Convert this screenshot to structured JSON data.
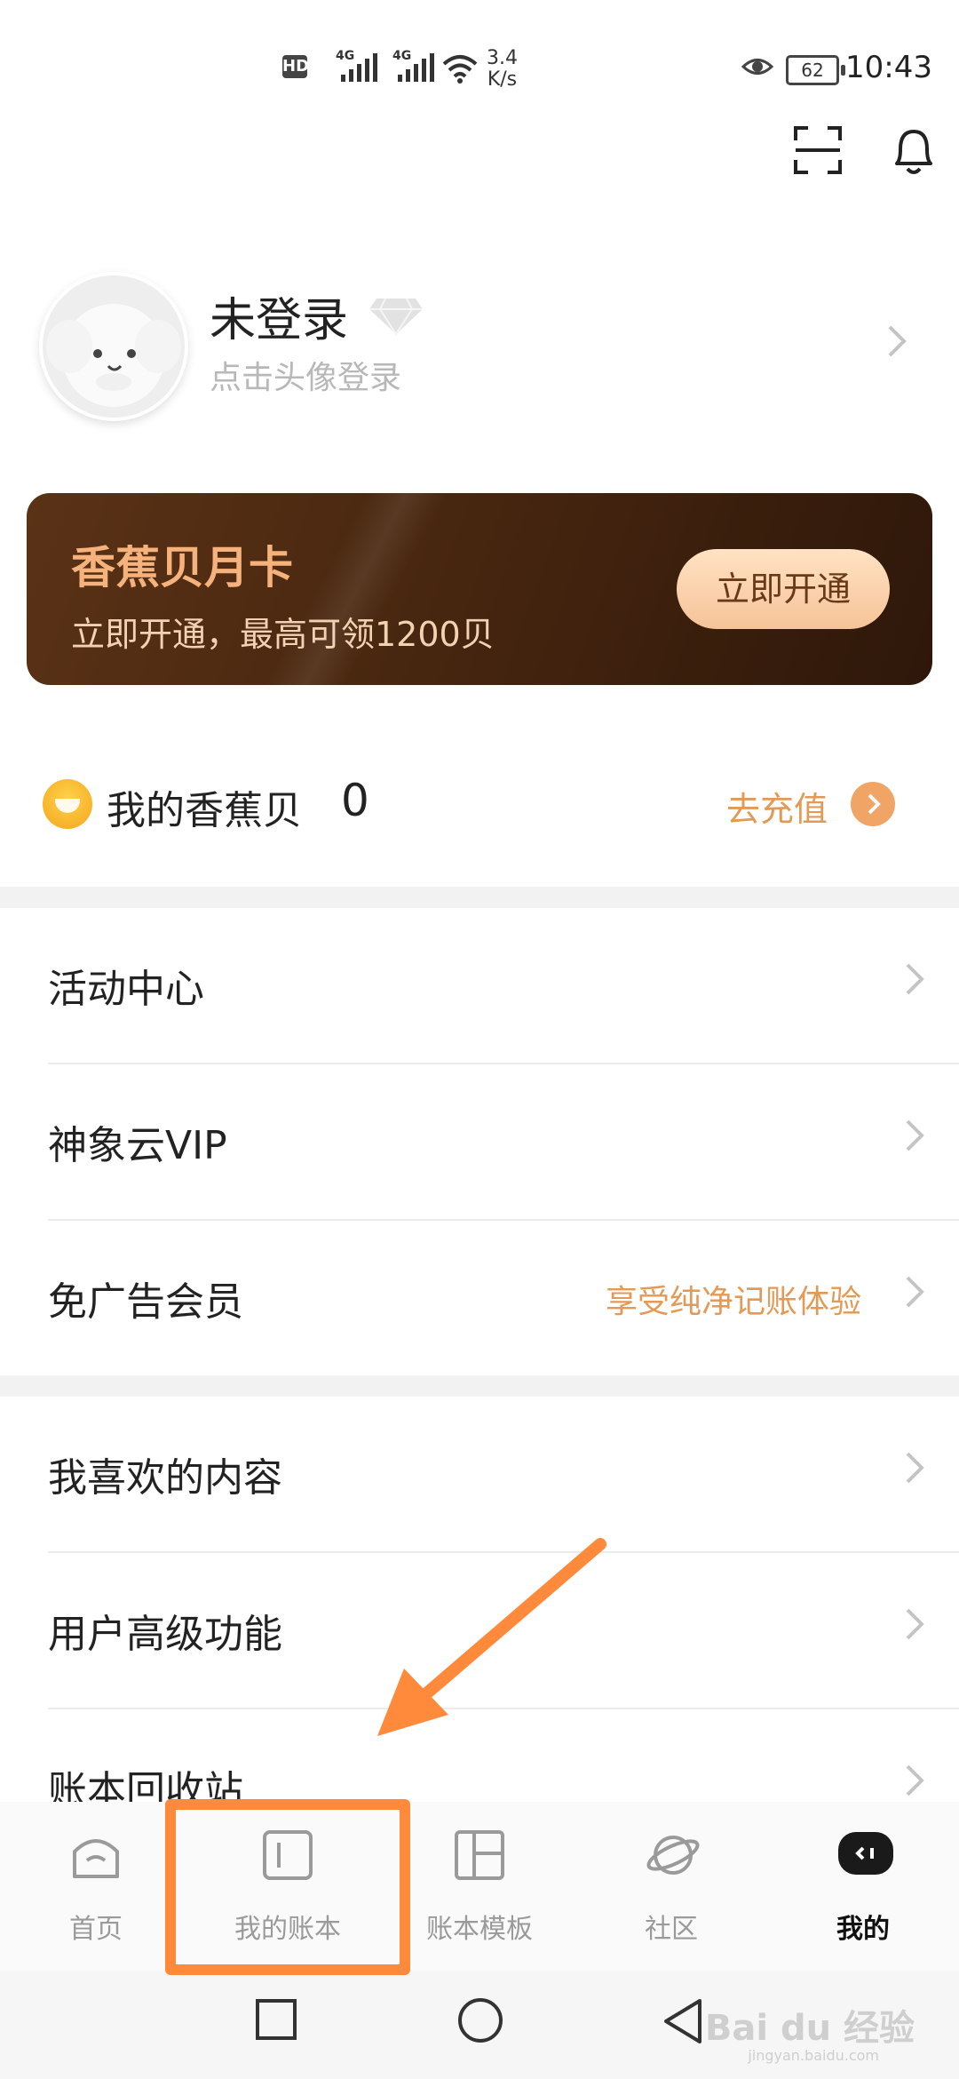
{
  "status_bar": {
    "hd": "HD",
    "sim1": "4G",
    "sim2": "4G",
    "speed_value": "3.4",
    "speed_unit": "K/s",
    "battery": "62",
    "time": "10:43"
  },
  "profile": {
    "name": "未登录",
    "subtitle": "点击头像登录"
  },
  "promo_card": {
    "title": "香蕉贝月卡",
    "subtitle": "立即开通，最高可领1200贝",
    "button": "立即开通"
  },
  "balance": {
    "label": "我的香蕉贝",
    "value": "0",
    "action": "去充值"
  },
  "menu_group_1": [
    {
      "label": "活动中心",
      "hint": ""
    },
    {
      "label": "神象云VIP",
      "hint": ""
    },
    {
      "label": "免广告会员",
      "hint": "享受纯净记账体验"
    }
  ],
  "menu_group_2": [
    {
      "label": "我喜欢的内容",
      "hint": ""
    },
    {
      "label": "用户高级功能",
      "hint": ""
    },
    {
      "label": "账本回收站",
      "hint": ""
    }
  ],
  "tabs": [
    {
      "label": "首页",
      "icon": "home-icon",
      "active": false
    },
    {
      "label": "我的账本",
      "icon": "ledger-icon",
      "active": false
    },
    {
      "label": "账本模板",
      "icon": "template-icon",
      "active": false
    },
    {
      "label": "社区",
      "icon": "planet-icon",
      "active": false
    },
    {
      "label": "我的",
      "icon": "mine-icon",
      "active": true
    }
  ],
  "watermark": {
    "text": "Bai du 经验",
    "sub": "jingyan.baidu.com"
  },
  "colors": {
    "accent": "#e39a56",
    "annotation": "#ff8a3c",
    "card_bg": "#4a2810"
  }
}
